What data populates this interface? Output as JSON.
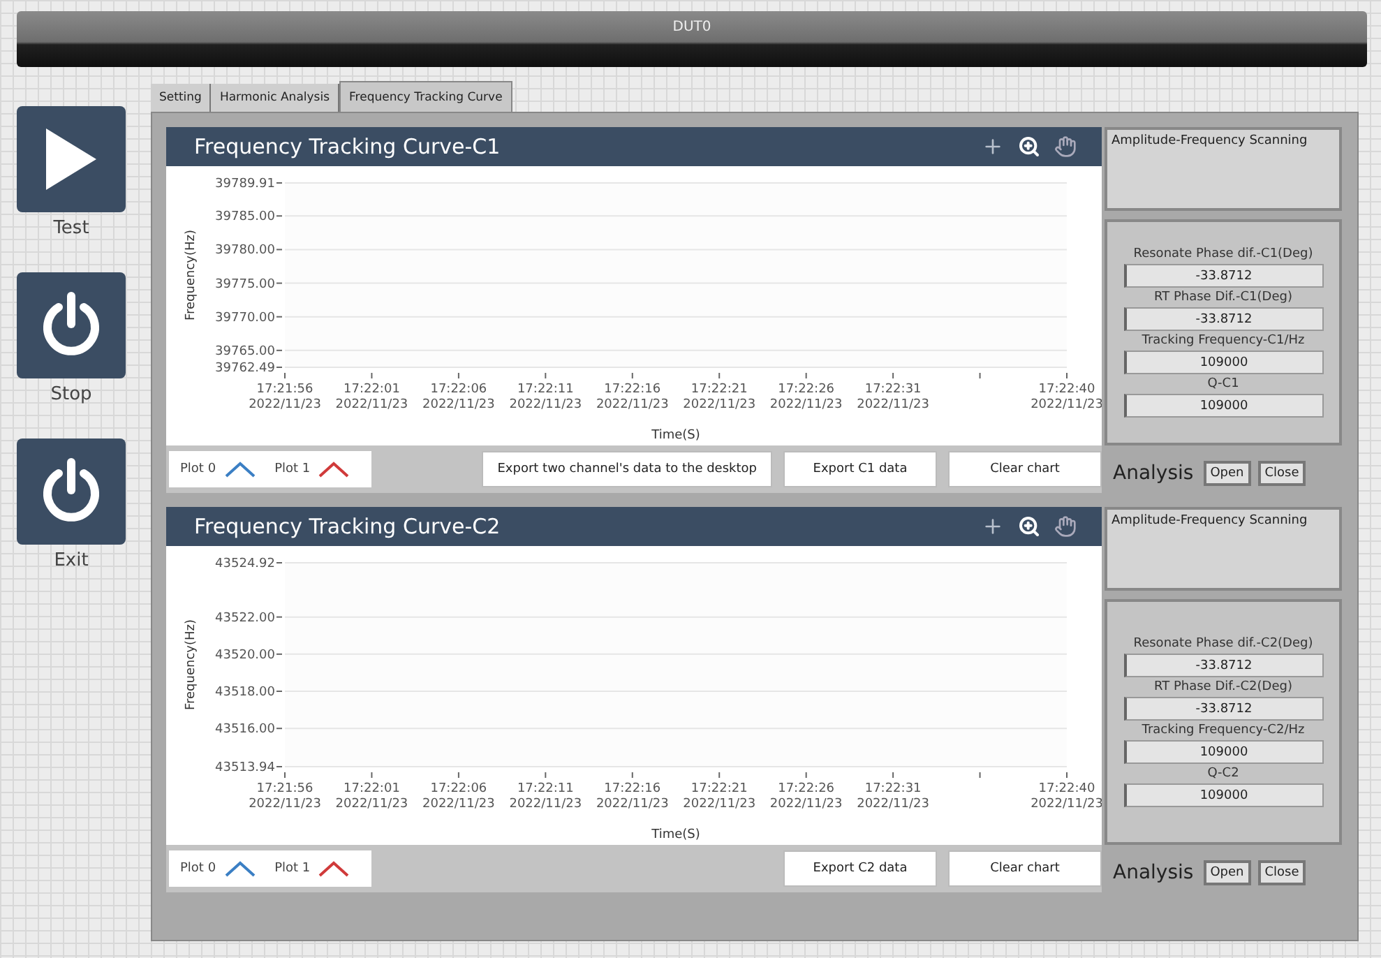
{
  "window": {
    "title": "DUT0"
  },
  "side_buttons": [
    {
      "label": "Test",
      "kind": "play"
    },
    {
      "label": "Stop",
      "kind": "power"
    },
    {
      "label": "Exit",
      "kind": "power"
    }
  ],
  "tabs": [
    {
      "label": "Setting",
      "selected": false
    },
    {
      "label": "Harmonic Analysis",
      "selected": false
    },
    {
      "label": "Frequency Tracking Curve",
      "selected": true
    }
  ],
  "channels": [
    {
      "title": "Frequency Tracking Curve-C1",
      "chart_data": {
        "type": "line",
        "xlabel": "Time(S)",
        "ylabel": "Frequency(Hz)",
        "grid": true,
        "ylim": [
          39762.49,
          39789.91
        ],
        "yticks": [
          {
            "value": 39762.49,
            "label": "39762.49"
          },
          {
            "value": 39765,
            "label": "39765.00"
          },
          {
            "value": 39770,
            "label": "39770.00"
          },
          {
            "value": 39775,
            "label": "39775.00"
          },
          {
            "value": 39780,
            "label": "39780.00"
          },
          {
            "value": 39785,
            "label": "39785.00"
          },
          {
            "value": 39789.91,
            "label": "39789.91"
          }
        ],
        "categories": [
          "17:21:56 2022/11/23",
          "17:22:01 2022/11/23",
          "17:22:06 2022/11/23",
          "17:22:11 2022/11/23",
          "17:22:16 2022/11/23",
          "17:22:21 2022/11/23",
          "17:22:26 2022/11/23",
          "17:22:31 2022/11/23",
          null,
          "17:22:40 2022/11/23"
        ]
      },
      "legend": [
        {
          "label": "Plot 0",
          "color": "#3b7fc4"
        },
        {
          "label": "Plot 1",
          "color": "#d03a3a"
        }
      ],
      "buttons": [
        "Export two channel's data to the desktop",
        "Export  C1 data",
        "Clear chart"
      ],
      "scan_box": {
        "label": "Amplitude-Frequency Scanning"
      },
      "readings": [
        {
          "label": "Resonate Phase dif.-C1(Deg)",
          "value": "-33.8712"
        },
        {
          "label": "RT Phase Dif.-C1(Deg)",
          "value": "-33.8712"
        },
        {
          "label": "Tracking Frequency-C1/Hz",
          "value": "109000"
        },
        {
          "label": "Q-C1",
          "value": "109000"
        }
      ],
      "analysis": {
        "label": "Analysis",
        "buttons": [
          "Open",
          "Close"
        ]
      }
    },
    {
      "title": "Frequency Tracking Curve-C2",
      "chart_data": {
        "type": "line",
        "xlabel": "Time(S)",
        "ylabel": "Frequency(Hz)",
        "grid": true,
        "ylim": [
          43513.94,
          43524.92
        ],
        "yticks": [
          {
            "value": 43513.94,
            "label": "43513.94"
          },
          {
            "value": 43516,
            "label": "43516.00"
          },
          {
            "value": 43518,
            "label": "43518.00"
          },
          {
            "value": 43520,
            "label": "43520.00"
          },
          {
            "value": 43522,
            "label": "43522.00"
          },
          {
            "value": 43524.92,
            "label": "43524.92"
          }
        ],
        "categories": [
          "17:21:56 2022/11/23",
          "17:22:01 2022/11/23",
          "17:22:06 2022/11/23",
          "17:22:11 2022/11/23",
          "17:22:16 2022/11/23",
          "17:22:21 2022/11/23",
          "17:22:26 2022/11/23",
          "17:22:31 2022/11/23",
          null,
          "17:22:40 2022/11/23"
        ]
      },
      "legend": [
        {
          "label": "Plot 0",
          "color": "#3b7fc4"
        },
        {
          "label": "Plot 1",
          "color": "#d03a3a"
        }
      ],
      "buttons": [
        "Export C2 data",
        "Clear chart"
      ],
      "scan_box": {
        "label": "Amplitude-Frequency Scanning"
      },
      "readings": [
        {
          "label": "Resonate Phase dif.-C2(Deg)",
          "value": "-33.8712"
        },
        {
          "label": "RT Phase Dif.-C2(Deg)",
          "value": "-33.8712"
        },
        {
          "label": "Tracking Frequency-C2/Hz",
          "value": "109000"
        },
        {
          "label": "Q-C2",
          "value": "109000"
        }
      ],
      "analysis": {
        "label": "Analysis",
        "buttons": [
          "Open",
          "Close"
        ]
      }
    }
  ]
}
